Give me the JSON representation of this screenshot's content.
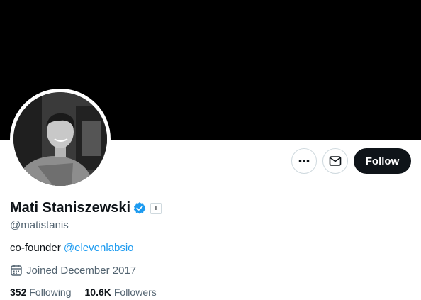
{
  "profile": {
    "display_name": "Mati Staniszewski",
    "handle": "@matistanis",
    "verified": true,
    "affiliate_badge": "II",
    "bio_prefix": "co-founder ",
    "bio_mention": "@elevenlabsio",
    "joined": "Joined December 2017"
  },
  "stats": {
    "following_count": "352",
    "following_label": "Following",
    "followers_count": "10.6K",
    "followers_label": "Followers"
  },
  "actions": {
    "more_icon": "more-horizontal-icon",
    "message_icon": "envelope-icon",
    "follow_label": "Follow"
  },
  "colors": {
    "banner": "#000000",
    "accent": "#1d9bf0",
    "text_primary": "#0f1419",
    "text_secondary": "#536471",
    "follow_button": "#0f1419"
  }
}
